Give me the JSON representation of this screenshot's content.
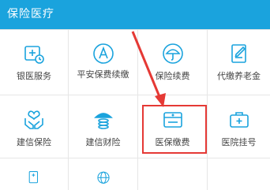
{
  "header": {
    "title": "保险医疗"
  },
  "grid": {
    "items": [
      {
        "label": "银医服务",
        "icon": "medical-calendar-icon"
      },
      {
        "label": "平安保费续缴",
        "icon": "letter-a-circle-icon"
      },
      {
        "label": "保险续费",
        "icon": "umbrella-icon"
      },
      {
        "label": "代缴养老金",
        "icon": "pen-document-icon"
      },
      {
        "label": "建信保险",
        "icon": "heart-hands-icon"
      },
      {
        "label": "建信财险",
        "icon": "umbrella-coins-icon"
      },
      {
        "label": "医保缴费",
        "icon": "medical-card-icon"
      },
      {
        "label": "医院挂号",
        "icon": "medical-kit-icon"
      },
      {
        "label": "",
        "icon": "medical-doc-icon"
      },
      {
        "label": "",
        "icon": "globe-icon"
      }
    ]
  },
  "annotation": {
    "color": "#e53935"
  },
  "colors": {
    "accent": "#1aa3dd",
    "text": "#444444"
  }
}
